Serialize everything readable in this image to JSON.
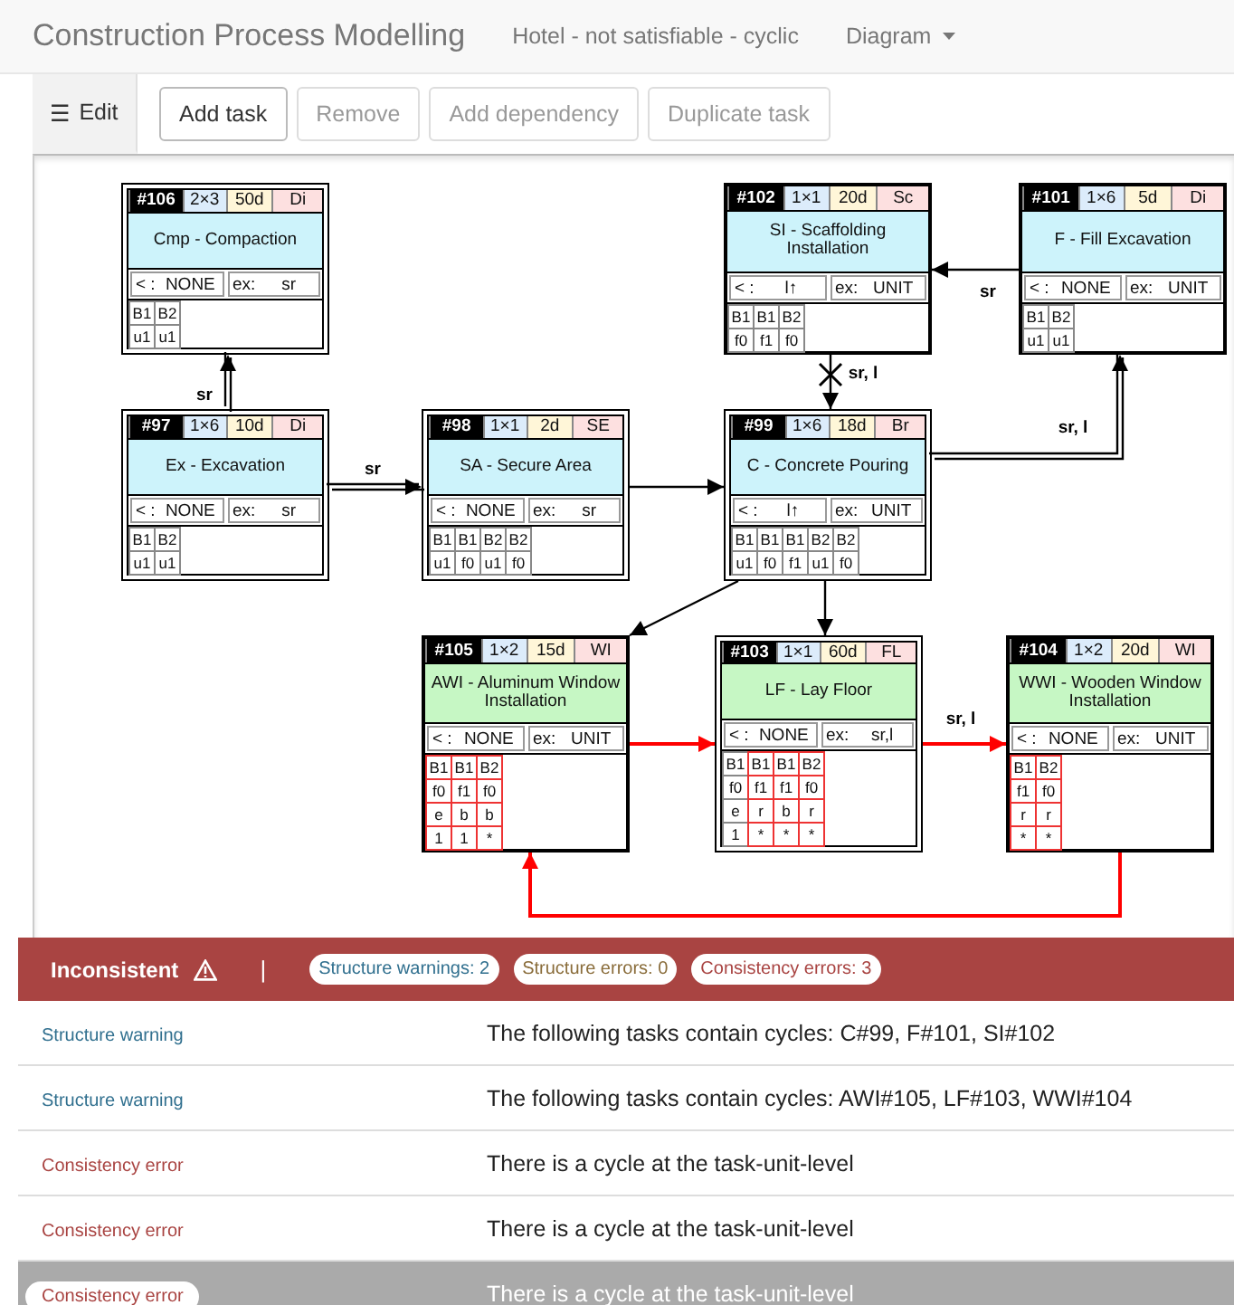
{
  "navbar": {
    "title": "Construction Process Modelling",
    "project": "Hotel - not satisfiable - cyclic",
    "menu": "Diagram"
  },
  "toolbar": {
    "tab": {
      "icon": "☰",
      "label": "Edit",
      "selected": true
    },
    "buttons": [
      {
        "label": "Add task",
        "disabled": false
      },
      {
        "label": "Remove",
        "disabled": true
      },
      {
        "label": "Add dependency",
        "disabled": true
      },
      {
        "label": "Duplicate task",
        "disabled": true
      }
    ]
  },
  "diagram": {
    "tasks": [
      {
        "id": "#106",
        "dims": "2×3",
        "duration": "50d",
        "trade": "Di",
        "name": "Cmp - Compaction",
        "color": "#cdf3fb",
        "double_frame": true,
        "before_label": "< :",
        "before": "NONE",
        "ex_label": "ex:",
        "ex": "sr",
        "units": [
          {
            "cells": [
              "B1",
              "u1"
            ],
            "flagged": false
          },
          {
            "cells": [
              "B2",
              "u1"
            ],
            "flagged": false
          }
        ]
      },
      {
        "id": "#102",
        "dims": "1×1",
        "duration": "20d",
        "trade": "Sc",
        "name": "SI - Scaffolding Installation",
        "color": "#cdf3fb",
        "double_frame": false,
        "before_label": "< :",
        "before": "l↑",
        "ex_label": "ex:",
        "ex": "UNIT",
        "units": [
          {
            "cells": [
              "B1",
              "f0"
            ],
            "flagged": false
          },
          {
            "cells": [
              "B1",
              "f1"
            ],
            "flagged": false
          },
          {
            "cells": [
              "B2",
              "f0"
            ],
            "flagged": false
          }
        ]
      },
      {
        "id": "#101",
        "dims": "1×6",
        "duration": "5d",
        "trade": "Di",
        "name": "F - Fill Excavation",
        "color": "#cdf3fb",
        "double_frame": false,
        "before_label": "< :",
        "before": "NONE",
        "ex_label": "ex:",
        "ex": "UNIT",
        "units": [
          {
            "cells": [
              "B1",
              "u1"
            ],
            "flagged": false
          },
          {
            "cells": [
              "B2",
              "u1"
            ],
            "flagged": false
          }
        ]
      },
      {
        "id": "#97",
        "dims": "1×6",
        "duration": "10d",
        "trade": "Di",
        "name": "Ex - Excavation",
        "color": "#cdf3fb",
        "double_frame": true,
        "before_label": "< :",
        "before": "NONE",
        "ex_label": "ex:",
        "ex": "sr",
        "units": [
          {
            "cells": [
              "B1",
              "u1"
            ],
            "flagged": false
          },
          {
            "cells": [
              "B2",
              "u1"
            ],
            "flagged": false
          }
        ]
      },
      {
        "id": "#98",
        "dims": "1×1",
        "duration": "2d",
        "trade": "SE",
        "name": "SA - Secure Area",
        "color": "#cdf3fb",
        "double_frame": true,
        "before_label": "< :",
        "before": "NONE",
        "ex_label": "ex:",
        "ex": "sr",
        "units": [
          {
            "cells": [
              "B1",
              "u1"
            ],
            "flagged": false
          },
          {
            "cells": [
              "B1",
              "f0"
            ],
            "flagged": false
          },
          {
            "cells": [
              "B2",
              "u1"
            ],
            "flagged": false
          },
          {
            "cells": [
              "B2",
              "f0"
            ],
            "flagged": false
          }
        ]
      },
      {
        "id": "#99",
        "dims": "1×6",
        "duration": "18d",
        "trade": "Br",
        "name": "C - Concrete Pouring",
        "color": "#cdf3fb",
        "double_frame": true,
        "before_label": "< :",
        "before": "l↑",
        "ex_label": "ex:",
        "ex": "UNIT",
        "units": [
          {
            "cells": [
              "B1",
              "u1"
            ],
            "flagged": false
          },
          {
            "cells": [
              "B1",
              "f0"
            ],
            "flagged": false
          },
          {
            "cells": [
              "B1",
              "f1"
            ],
            "flagged": false
          },
          {
            "cells": [
              "B2",
              "u1"
            ],
            "flagged": false
          },
          {
            "cells": [
              "B2",
              "f0"
            ],
            "flagged": false
          }
        ]
      },
      {
        "id": "#105",
        "dims": "1×2",
        "duration": "15d",
        "trade": "WI",
        "name": "AWI - Aluminum Window Installation",
        "color": "#c6f7c4",
        "double_frame": false,
        "before_label": "< :",
        "before": "NONE",
        "ex_label": "ex:",
        "ex": "UNIT",
        "units": [
          {
            "cells": [
              "B1",
              "f0",
              "e",
              "1"
            ],
            "flagged": true
          },
          {
            "cells": [
              "B1",
              "f1",
              "b",
              "1"
            ],
            "flagged": true
          },
          {
            "cells": [
              "B2",
              "f0",
              "b",
              "*"
            ],
            "flagged": true
          }
        ]
      },
      {
        "id": "#103",
        "dims": "1×1",
        "duration": "60d",
        "trade": "FL",
        "name": "LF - Lay Floor",
        "color": "#c6f7c4",
        "double_frame": true,
        "before_label": "< :",
        "before": "NONE",
        "ex_label": "ex:",
        "ex": "sr,l",
        "units": [
          {
            "cells": [
              "B1",
              "f0",
              "e",
              "1"
            ],
            "flagged": false
          },
          {
            "cells": [
              "B1",
              "f1",
              "r",
              "*"
            ],
            "flagged": true
          },
          {
            "cells": [
              "B1",
              "f1",
              "b",
              "*"
            ],
            "flagged": true
          },
          {
            "cells": [
              "B2",
              "f0",
              "r",
              "*"
            ],
            "flagged": true
          }
        ]
      },
      {
        "id": "#104",
        "dims": "1×2",
        "duration": "20d",
        "trade": "WI",
        "name": "WWI - Wooden Window Installation",
        "color": "#c6f7c4",
        "double_frame": false,
        "before_label": "< :",
        "before": "NONE",
        "ex_label": "ex:",
        "ex": "UNIT",
        "units": [
          {
            "cells": [
              "B1",
              "f1",
              "r",
              "*"
            ],
            "flagged": true
          },
          {
            "cells": [
              "B2",
              "f0",
              "r",
              "*"
            ],
            "flagged": true
          }
        ]
      }
    ],
    "dependencies": [
      {
        "label": "sr",
        "double_line": true,
        "color": "#000000"
      },
      {
        "label": "sr",
        "double_line": true,
        "color": "#000000"
      },
      {
        "double_line": false,
        "color": "#000000"
      },
      {
        "label": "sr",
        "double_line": false,
        "color": "#000000"
      },
      {
        "label": "sr, l",
        "double_line": false,
        "color": "#000000",
        "crossed": true
      },
      {
        "label": "sr, l",
        "double_line": true,
        "color": "#000000"
      },
      {
        "double_line": false,
        "color": "#000000"
      },
      {
        "double_line": false,
        "color": "#000000"
      },
      {
        "double_line": false,
        "color": "#ff0000"
      },
      {
        "label": "sr, l",
        "double_line": false,
        "color": "#ff0000"
      },
      {
        "double_line": false,
        "color": "#ff0000"
      }
    ]
  },
  "status": {
    "label": "Inconsistent",
    "separator": "|",
    "badges": [
      {
        "label": "Structure warnings: 2",
        "kind": "warning"
      },
      {
        "label": "Structure errors: 0",
        "kind": "structure_error"
      },
      {
        "label": "Consistency errors: 3",
        "kind": "error"
      }
    ],
    "messages": [
      {
        "category": "Structure warning",
        "kind": "warning",
        "text": "The following tasks contain cycles: C#99, F#101, SI#102",
        "selected": false
      },
      {
        "category": "Structure warning",
        "kind": "warning",
        "text": "The following tasks contain cycles: AWI#105, LF#103, WWI#104",
        "selected": false
      },
      {
        "category": "Consistency error",
        "kind": "error",
        "text": "There is a cycle at the task-unit-level",
        "selected": false
      },
      {
        "category": "Consistency error",
        "kind": "error",
        "text": "There is a cycle at the task-unit-level",
        "selected": false
      },
      {
        "category": "Consistency error",
        "kind": "error",
        "text": "There is a cycle at the task-unit-level",
        "selected": true
      }
    ]
  }
}
